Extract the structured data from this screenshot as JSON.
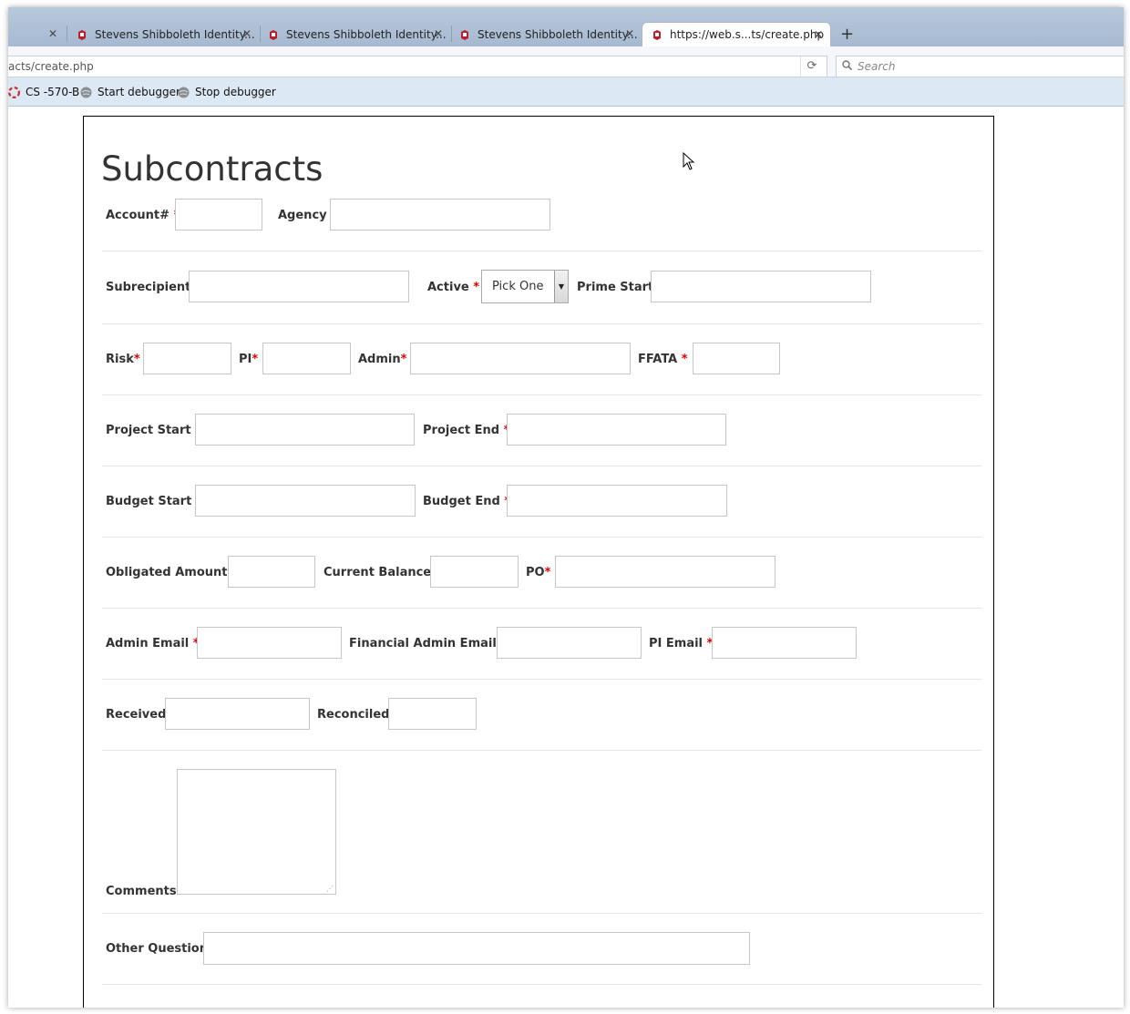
{
  "browser": {
    "tabs": [
      {
        "label": "Stevens Shibboleth Identity..."
      },
      {
        "label": "Stevens Shibboleth Identity..."
      },
      {
        "label": "Stevens Shibboleth Identity..."
      },
      {
        "label": "https://web.s...ts/create.php"
      }
    ],
    "url": "acts/create.php",
    "search_placeholder": "Search",
    "bookmarks": [
      {
        "label": "CS -570-B"
      },
      {
        "label": "Start debugger"
      },
      {
        "label": "Stop debugger"
      }
    ]
  },
  "form": {
    "title": "Subcontracts",
    "required_mark": "*",
    "rows": {
      "r1": {
        "account": "Account#",
        "agency": "Agency"
      },
      "r2": {
        "subrecipient": "Subrecipient",
        "active": "Active",
        "active_value": "Pick One",
        "prime_start": "Prime Start"
      },
      "r3": {
        "risk": "Risk",
        "pi": "PI",
        "admin": "Admin",
        "ffata": "FFATA"
      },
      "r4": {
        "project_start": "Project Start",
        "project_end": "Project End"
      },
      "r5": {
        "budget_start": "Budget Start",
        "budget_end": "Budget End"
      },
      "r6": {
        "obligated_amount": "Obligated Amount",
        "current_balance": "Current Balance",
        "po": "PO"
      },
      "r7": {
        "admin_email": "Admin Email",
        "financial_admin_email": "Financial Admin Email",
        "pi_email": "PI Email"
      },
      "r8": {
        "received": "Received",
        "reconciled": "Reconciled"
      },
      "r9": {
        "comments": "Comments"
      },
      "r10": {
        "other_question": "Other Question"
      }
    }
  },
  "colors": {
    "required": "#dd0000",
    "label": "#333333",
    "tabstrip": "#b9c9dc",
    "bookmarks_bar": "#dde8f5"
  }
}
